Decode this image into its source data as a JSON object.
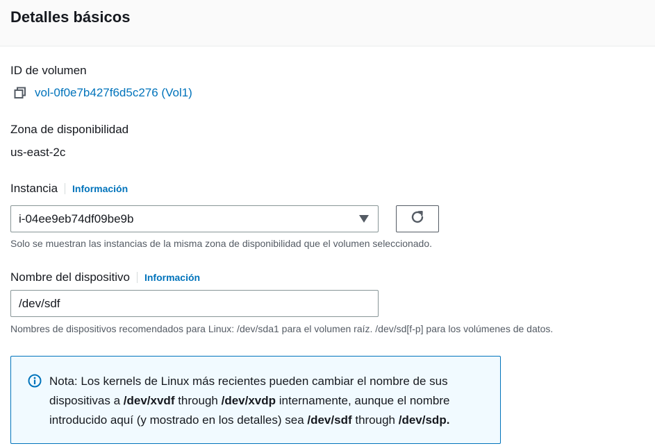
{
  "header": {
    "title": "Detalles básicos"
  },
  "volume": {
    "label": "ID de volumen",
    "link_text": "vol-0f0e7b427f6d5c276 (Vol1)"
  },
  "az": {
    "label": "Zona de disponibilidad",
    "value": "us-east-2c"
  },
  "instance": {
    "label": "Instancia",
    "info": "Información",
    "selected": "i-04ee9eb74df09be9b",
    "hint": "Solo se muestran las instancias de la misma zona de disponibilidad que el volumen seleccionado."
  },
  "device": {
    "label": "Nombre del dispositivo",
    "info": "Información",
    "value": "/dev/sdf",
    "hint": "Nombres de dispositivos recomendados para Linux: /dev/sda1 para el volumen raíz. /dev/sd[f-p] para los volúmenes de datos."
  },
  "note": {
    "t1": "Nota: Los kernels de Linux más recientes pueden cambiar el nombre de sus dispositivas a ",
    "b1": "/dev/xvdf",
    "t2": " through ",
    "b2": "/dev/xvdp",
    "t3": " internamente, aunque el nombre introducido aquí (y mostrado en los detalles) sea ",
    "b3": "/dev/sdf",
    "t4": " through ",
    "b4": "/dev/sdp."
  },
  "colors": {
    "link": "#0073bb",
    "alert_border": "#0073bb",
    "alert_bg": "#f1faff"
  },
  "icons": [
    "copy-icon",
    "chevron-down-icon",
    "refresh-icon",
    "info-circle-icon"
  ]
}
